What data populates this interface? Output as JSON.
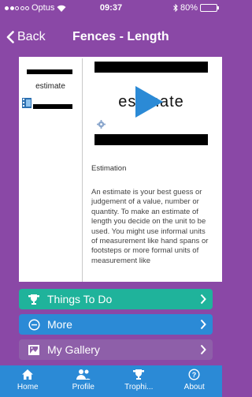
{
  "status": {
    "carrier": "Optus",
    "time": "09:37",
    "battery": "80%",
    "battery_level": 0.8
  },
  "nav": {
    "back_label": "Back",
    "title": "Fences - Length"
  },
  "content": {
    "thumb_label": "estimate",
    "video_word": "estimate",
    "section_title": "Estimation",
    "paragraph": "An estimate is your best guess or judgement of a value, number or quantity. To make an estimate of length you decide on the unit to be used. You might use informal units of measurement like hand spans or footsteps or more formal units of measurement like"
  },
  "buttons": [
    {
      "label": "Things To Do",
      "icon": "trophy-icon",
      "color": "#1fb39b"
    },
    {
      "label": "More",
      "icon": "minus-circle-icon",
      "color": "#2b8ad6"
    },
    {
      "label": "My Gallery",
      "icon": "gallery-icon",
      "color": "#8e5fa9"
    }
  ],
  "tabs": [
    {
      "label": "Home",
      "icon": "home-icon"
    },
    {
      "label": "Profile",
      "icon": "profile-icon"
    },
    {
      "label": "Trophi...",
      "icon": "trophy-icon"
    },
    {
      "label": "About",
      "icon": "question-icon"
    }
  ],
  "colors": {
    "background": "#8a48a6",
    "accent_blue": "#2b8ad6",
    "accent_teal": "#1fb39b"
  }
}
